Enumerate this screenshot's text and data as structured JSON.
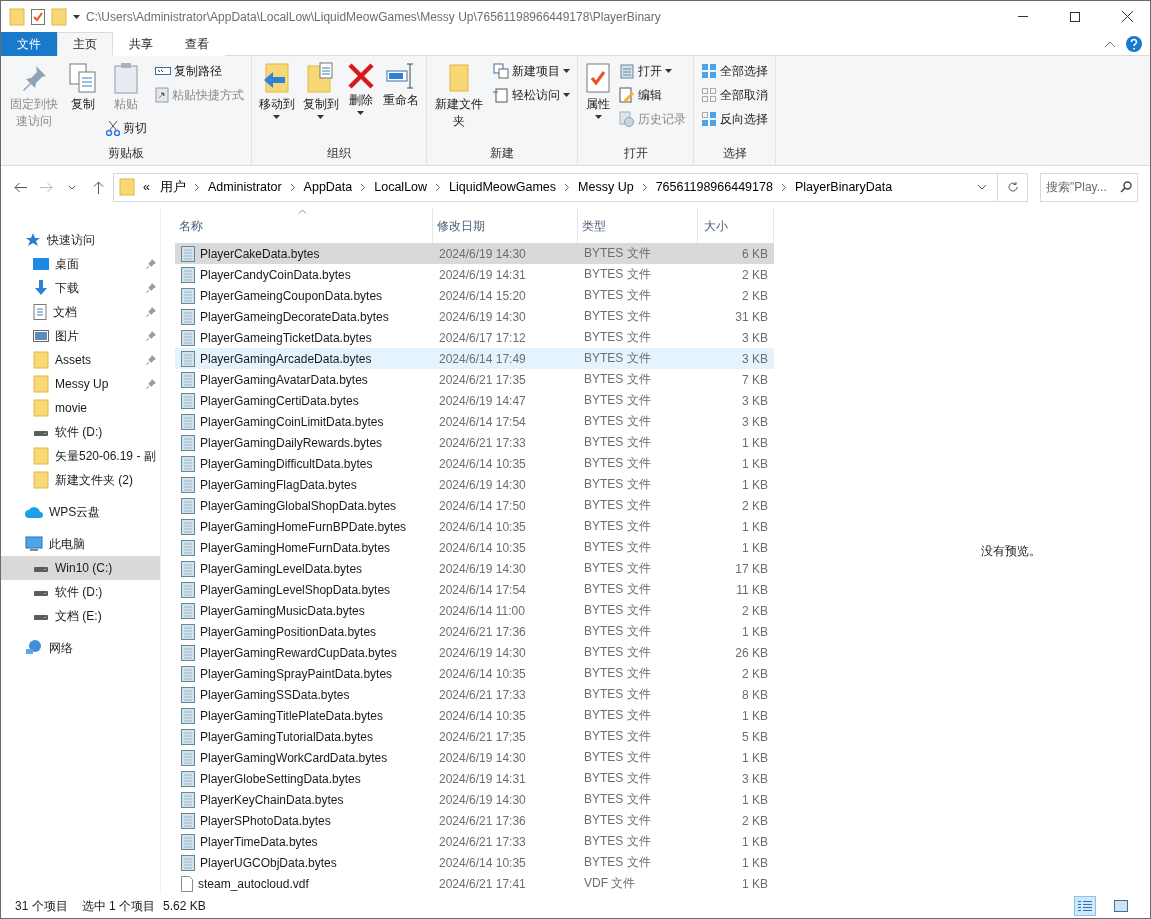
{
  "window": {
    "title": "C:\\Users\\Administrator\\AppData\\LocalLow\\LiquidMeowGames\\Messy Up\\76561198966449178\\PlayerBinary"
  },
  "tabs": [
    {
      "label": "文件",
      "kind": "file",
      "selected": false
    },
    {
      "label": "主页",
      "kind": "tab",
      "selected": true
    },
    {
      "label": "共享",
      "kind": "tab",
      "selected": false
    },
    {
      "label": "查看",
      "kind": "tab",
      "selected": false
    }
  ],
  "ribbon": [
    {
      "label": "剪贴板",
      "columns": [
        [
          {
            "label": "固定到快速访问",
            "kind": "large",
            "disabled": true,
            "dropdown": false
          }
        ],
        [
          {
            "label": "复制",
            "kind": "large",
            "disabled": false,
            "dropdown": false
          }
        ],
        [
          {
            "label": "粘贴",
            "kind": "large",
            "disabled": true,
            "dropdown": false
          },
          {
            "label": "剪切",
            "kind": "small",
            "disabled": false,
            "dropdown": false
          }
        ],
        [
          {
            "label": "复制路径",
            "kind": "small",
            "disabled": false,
            "dropdown": false
          },
          {
            "label": "粘贴快捷方式",
            "kind": "small",
            "disabled": true,
            "dropdown": false
          }
        ]
      ]
    },
    {
      "label": "组织",
      "columns": [
        [
          {
            "label": "移动到",
            "kind": "large",
            "disabled": false,
            "dropdown": true
          }
        ],
        [
          {
            "label": "复制到",
            "kind": "large",
            "disabled": false,
            "dropdown": true
          }
        ],
        [
          {
            "label": "删除",
            "kind": "large",
            "disabled": false,
            "dropdown": true
          }
        ],
        [
          {
            "label": "重命名",
            "kind": "large",
            "disabled": false,
            "dropdown": false
          }
        ]
      ]
    },
    {
      "label": "新建",
      "columns": [
        [
          {
            "label": "新建文件夹",
            "kind": "large",
            "disabled": false,
            "dropdown": false
          }
        ],
        [
          {
            "label": "新建项目",
            "kind": "small",
            "disabled": false,
            "dropdown": true
          },
          {
            "label": "轻松访问",
            "kind": "small",
            "disabled": false,
            "dropdown": true
          }
        ]
      ]
    },
    {
      "label": "打开",
      "columns": [
        [
          {
            "label": "属性",
            "kind": "large",
            "disabled": false,
            "dropdown": true
          }
        ],
        [
          {
            "label": "打开",
            "kind": "small",
            "disabled": false,
            "dropdown": true
          },
          {
            "label": "编辑",
            "kind": "small",
            "disabled": false,
            "dropdown": false
          },
          {
            "label": "历史记录",
            "kind": "small",
            "disabled": true,
            "dropdown": false
          }
        ]
      ]
    },
    {
      "label": "选择",
      "columns": [
        [
          {
            "label": "全部选择",
            "kind": "small",
            "disabled": false,
            "dropdown": false
          },
          {
            "label": "全部取消",
            "kind": "small",
            "disabled": false,
            "dropdown": false
          },
          {
            "label": "反向选择",
            "kind": "small",
            "disabled": false,
            "dropdown": false
          }
        ]
      ]
    }
  ],
  "address": {
    "overflow": "«",
    "crumbs": [
      "用户",
      "Administrator",
      "AppData",
      "LocalLow",
      "LiquidMeowGames",
      "Messy Up",
      "76561198966449178",
      "PlayerBinaryData"
    ]
  },
  "search": {
    "placeholder": "搜索\"Play..."
  },
  "sidebar": {
    "items": [
      {
        "label": "快速访问",
        "kind": "star",
        "selected": false,
        "pinned": false,
        "children": [
          {
            "label": "桌面",
            "kind": "desktop",
            "selected": false,
            "pinned": true
          },
          {
            "label": "下载",
            "kind": "download",
            "selected": false,
            "pinned": true
          },
          {
            "label": "文档",
            "kind": "document",
            "selected": false,
            "pinned": true
          },
          {
            "label": "图片",
            "kind": "picture",
            "selected": false,
            "pinned": true
          },
          {
            "label": "Assets",
            "kind": "folder",
            "selected": false,
            "pinned": true
          },
          {
            "label": "Messy Up",
            "kind": "folder",
            "selected": false,
            "pinned": true
          },
          {
            "label": "movie",
            "kind": "folder",
            "selected": false,
            "pinned": false
          },
          {
            "label": "软件 (D:)",
            "kind": "drive",
            "selected": false,
            "pinned": false
          },
          {
            "label": "矢量520-06.19 - 副",
            "kind": "folder",
            "selected": false,
            "pinned": false
          },
          {
            "label": "新建文件夹 (2)",
            "kind": "folder",
            "selected": false,
            "pinned": false
          }
        ]
      },
      {
        "label": "WPS云盘",
        "kind": "cloud",
        "selected": false,
        "pinned": false
      },
      {
        "label": "此电脑",
        "kind": "pc",
        "selected": false,
        "pinned": false,
        "children": [
          {
            "label": "Win10 (C:)",
            "kind": "drive",
            "selected": true,
            "pinned": false
          },
          {
            "label": "软件 (D:)",
            "kind": "drive",
            "selected": false,
            "pinned": false
          },
          {
            "label": "文档 (E:)",
            "kind": "drive",
            "selected": false,
            "pinned": false
          }
        ]
      },
      {
        "label": "网络",
        "kind": "network",
        "selected": false,
        "pinned": false
      }
    ]
  },
  "table": {
    "columns": [
      "名称",
      "修改日期",
      "类型",
      "大小"
    ],
    "rows": [
      {
        "name": "PlayerCakeData.bytes",
        "date": "2024/6/19 14:30",
        "type": "BYTES 文件",
        "size": "6 KB",
        "kind": "bytes",
        "selected": true,
        "hovered": false
      },
      {
        "name": "PlayerCandyCoinData.bytes",
        "date": "2024/6/19 14:31",
        "type": "BYTES 文件",
        "size": "2 KB",
        "kind": "bytes",
        "selected": false,
        "hovered": false
      },
      {
        "name": "PlayerGameingCouponData.bytes",
        "date": "2024/6/14 15:20",
        "type": "BYTES 文件",
        "size": "2 KB",
        "kind": "bytes",
        "selected": false,
        "hovered": false
      },
      {
        "name": "PlayerGameingDecorateData.bytes",
        "date": "2024/6/19 14:30",
        "type": "BYTES 文件",
        "size": "31 KB",
        "kind": "bytes",
        "selected": false,
        "hovered": false
      },
      {
        "name": "PlayerGameingTicketData.bytes",
        "date": "2024/6/17 17:12",
        "type": "BYTES 文件",
        "size": "3 KB",
        "kind": "bytes",
        "selected": false,
        "hovered": false
      },
      {
        "name": "PlayerGamingArcadeData.bytes",
        "date": "2024/6/14 17:49",
        "type": "BYTES 文件",
        "size": "3 KB",
        "kind": "bytes",
        "selected": false,
        "hovered": true
      },
      {
        "name": "PlayerGamingAvatarData.bytes",
        "date": "2024/6/21 17:35",
        "type": "BYTES 文件",
        "size": "7 KB",
        "kind": "bytes",
        "selected": false,
        "hovered": false
      },
      {
        "name": "PlayerGamingCertiData.bytes",
        "date": "2024/6/19 14:47",
        "type": "BYTES 文件",
        "size": "3 KB",
        "kind": "bytes",
        "selected": false,
        "hovered": false
      },
      {
        "name": "PlayerGamingCoinLimitData.bytes",
        "date": "2024/6/14 17:54",
        "type": "BYTES 文件",
        "size": "3 KB",
        "kind": "bytes",
        "selected": false,
        "hovered": false
      },
      {
        "name": "PlayerGamingDailyRewards.bytes",
        "date": "2024/6/21 17:33",
        "type": "BYTES 文件",
        "size": "1 KB",
        "kind": "bytes",
        "selected": false,
        "hovered": false
      },
      {
        "name": "PlayerGamingDifficultData.bytes",
        "date": "2024/6/14 10:35",
        "type": "BYTES 文件",
        "size": "1 KB",
        "kind": "bytes",
        "selected": false,
        "hovered": false
      },
      {
        "name": "PlayerGamingFlagData.bytes",
        "date": "2024/6/19 14:30",
        "type": "BYTES 文件",
        "size": "1 KB",
        "kind": "bytes",
        "selected": false,
        "hovered": false
      },
      {
        "name": "PlayerGamingGlobalShopData.bytes",
        "date": "2024/6/14 17:50",
        "type": "BYTES 文件",
        "size": "2 KB",
        "kind": "bytes",
        "selected": false,
        "hovered": false
      },
      {
        "name": "PlayerGamingHomeFurnBPDate.bytes",
        "date": "2024/6/14 10:35",
        "type": "BYTES 文件",
        "size": "1 KB",
        "kind": "bytes",
        "selected": false,
        "hovered": false
      },
      {
        "name": "PlayerGamingHomeFurnData.bytes",
        "date": "2024/6/14 10:35",
        "type": "BYTES 文件",
        "size": "1 KB",
        "kind": "bytes",
        "selected": false,
        "hovered": false
      },
      {
        "name": "PlayerGamingLevelData.bytes",
        "date": "2024/6/19 14:30",
        "type": "BYTES 文件",
        "size": "17 KB",
        "kind": "bytes",
        "selected": false,
        "hovered": false
      },
      {
        "name": "PlayerGamingLevelShopData.bytes",
        "date": "2024/6/14 17:54",
        "type": "BYTES 文件",
        "size": "11 KB",
        "kind": "bytes",
        "selected": false,
        "hovered": false
      },
      {
        "name": "PlayerGamingMusicData.bytes",
        "date": "2024/6/14 11:00",
        "type": "BYTES 文件",
        "size": "2 KB",
        "kind": "bytes",
        "selected": false,
        "hovered": false
      },
      {
        "name": "PlayerGamingPositionData.bytes",
        "date": "2024/6/21 17:36",
        "type": "BYTES 文件",
        "size": "1 KB",
        "kind": "bytes",
        "selected": false,
        "hovered": false
      },
      {
        "name": "PlayerGamingRewardCupData.bytes",
        "date": "2024/6/19 14:30",
        "type": "BYTES 文件",
        "size": "26 KB",
        "kind": "bytes",
        "selected": false,
        "hovered": false
      },
      {
        "name": "PlayerGamingSprayPaintData.bytes",
        "date": "2024/6/14 10:35",
        "type": "BYTES 文件",
        "size": "2 KB",
        "kind": "bytes",
        "selected": false,
        "hovered": false
      },
      {
        "name": "PlayerGamingSSData.bytes",
        "date": "2024/6/21 17:33",
        "type": "BYTES 文件",
        "size": "8 KB",
        "kind": "bytes",
        "selected": false,
        "hovered": false
      },
      {
        "name": "PlayerGamingTitlePlateData.bytes",
        "date": "2024/6/14 10:35",
        "type": "BYTES 文件",
        "size": "1 KB",
        "kind": "bytes",
        "selected": false,
        "hovered": false
      },
      {
        "name": "PlayerGamingTutorialData.bytes",
        "date": "2024/6/21 17:35",
        "type": "BYTES 文件",
        "size": "5 KB",
        "kind": "bytes",
        "selected": false,
        "hovered": false
      },
      {
        "name": "PlayerGamingWorkCardData.bytes",
        "date": "2024/6/19 14:30",
        "type": "BYTES 文件",
        "size": "1 KB",
        "kind": "bytes",
        "selected": false,
        "hovered": false
      },
      {
        "name": "PlayerGlobeSettingData.bytes",
        "date": "2024/6/19 14:31",
        "type": "BYTES 文件",
        "size": "3 KB",
        "kind": "bytes",
        "selected": false,
        "hovered": false
      },
      {
        "name": "PlayerKeyChainData.bytes",
        "date": "2024/6/19 14:30",
        "type": "BYTES 文件",
        "size": "1 KB",
        "kind": "bytes",
        "selected": false,
        "hovered": false
      },
      {
        "name": "PlayerSPhotoData.bytes",
        "date": "2024/6/21 17:36",
        "type": "BYTES 文件",
        "size": "2 KB",
        "kind": "bytes",
        "selected": false,
        "hovered": false
      },
      {
        "name": "PlayerTimeData.bytes",
        "date": "2024/6/21 17:33",
        "type": "BYTES 文件",
        "size": "1 KB",
        "kind": "bytes",
        "selected": false,
        "hovered": false
      },
      {
        "name": "PlayerUGCObjData.bytes",
        "date": "2024/6/14 10:35",
        "type": "BYTES 文件",
        "size": "1 KB",
        "kind": "bytes",
        "selected": false,
        "hovered": false
      },
      {
        "name": "steam_autocloud.vdf",
        "date": "2024/6/21 17:41",
        "type": "VDF 文件",
        "size": "1 KB",
        "kind": "plain",
        "selected": false,
        "hovered": false
      }
    ]
  },
  "preview": {
    "message": "没有预览。"
  },
  "status_bar": {
    "count": "31 个项目",
    "selection": "选中 1 个项目",
    "size": "5.62 KB",
    "views": [
      {
        "kind": "details",
        "selected": true
      },
      {
        "kind": "large-icons",
        "selected": false
      }
    ]
  }
}
